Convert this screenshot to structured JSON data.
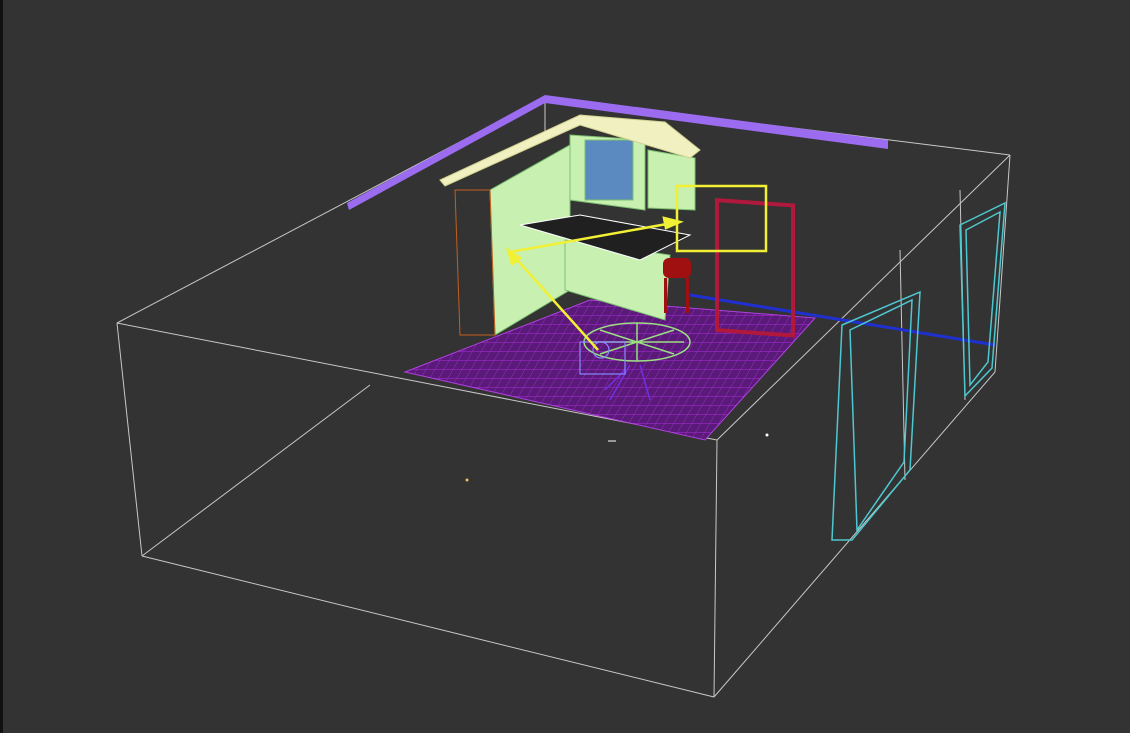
{
  "viewport": {
    "background": "#333333",
    "colors": {
      "room_wire": "#c8c8c8",
      "cabinets": "#c8f0b0",
      "floor_grid": "#7a1fa0",
      "wall_molding": "#9b6cf0",
      "light_arrow": "#f2f034",
      "frame": "#b0183c",
      "window": "#4ec8d0",
      "baseline": "#2030d0",
      "stool": "#a01010"
    }
  }
}
